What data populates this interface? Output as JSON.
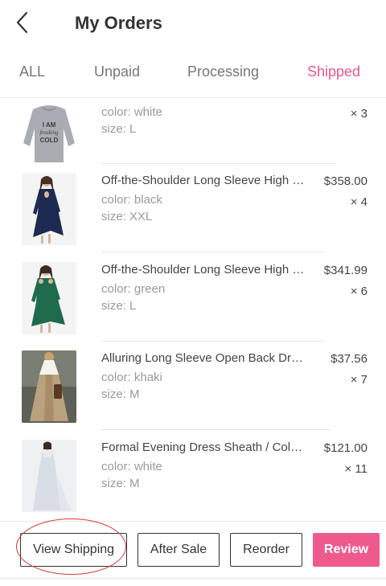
{
  "header": {
    "title": "My Orders",
    "back_icon": "chevron-left-icon"
  },
  "tabs": [
    {
      "label": "ALL",
      "active": false
    },
    {
      "label": "Unpaid",
      "active": false
    },
    {
      "label": "Processing",
      "active": false
    },
    {
      "label": "Shipped",
      "active": true
    }
  ],
  "accent_color": "#ef5a8d",
  "annotation_color": "#d73a3a",
  "orders": [
    {
      "name": "",
      "color": "color: white",
      "size": "size: L",
      "price": "",
      "qty": "× 3"
    },
    {
      "name": "Off-the-Shoulder Long Sleeve High Low Dress",
      "color": "color: black",
      "size": "size: XXL",
      "price": "$358.00",
      "qty": "× 4"
    },
    {
      "name": "Off-the-Shoulder Long Sleeve High Low Dress",
      "color": "color: green",
      "size": "size: L",
      "price": "$341.99",
      "qty": "× 6"
    },
    {
      "name": "Alluring Long Sleeve Open Back Dress",
      "color": "color: khaki",
      "size": "size: M",
      "price": "$37.56",
      "qty": "× 7"
    },
    {
      "name": "Formal Evening Dress Sheath / Column",
      "color": "color: white",
      "size": "size: M",
      "price": "$121.00",
      "qty": "× 11"
    }
  ],
  "sweatshirt_print": [
    "I AM",
    "freaking",
    "COLD"
  ],
  "actions": {
    "view_shipping": "View Shipping",
    "after_sale": "After Sale",
    "reorder": "Reorder",
    "review": "Review"
  }
}
